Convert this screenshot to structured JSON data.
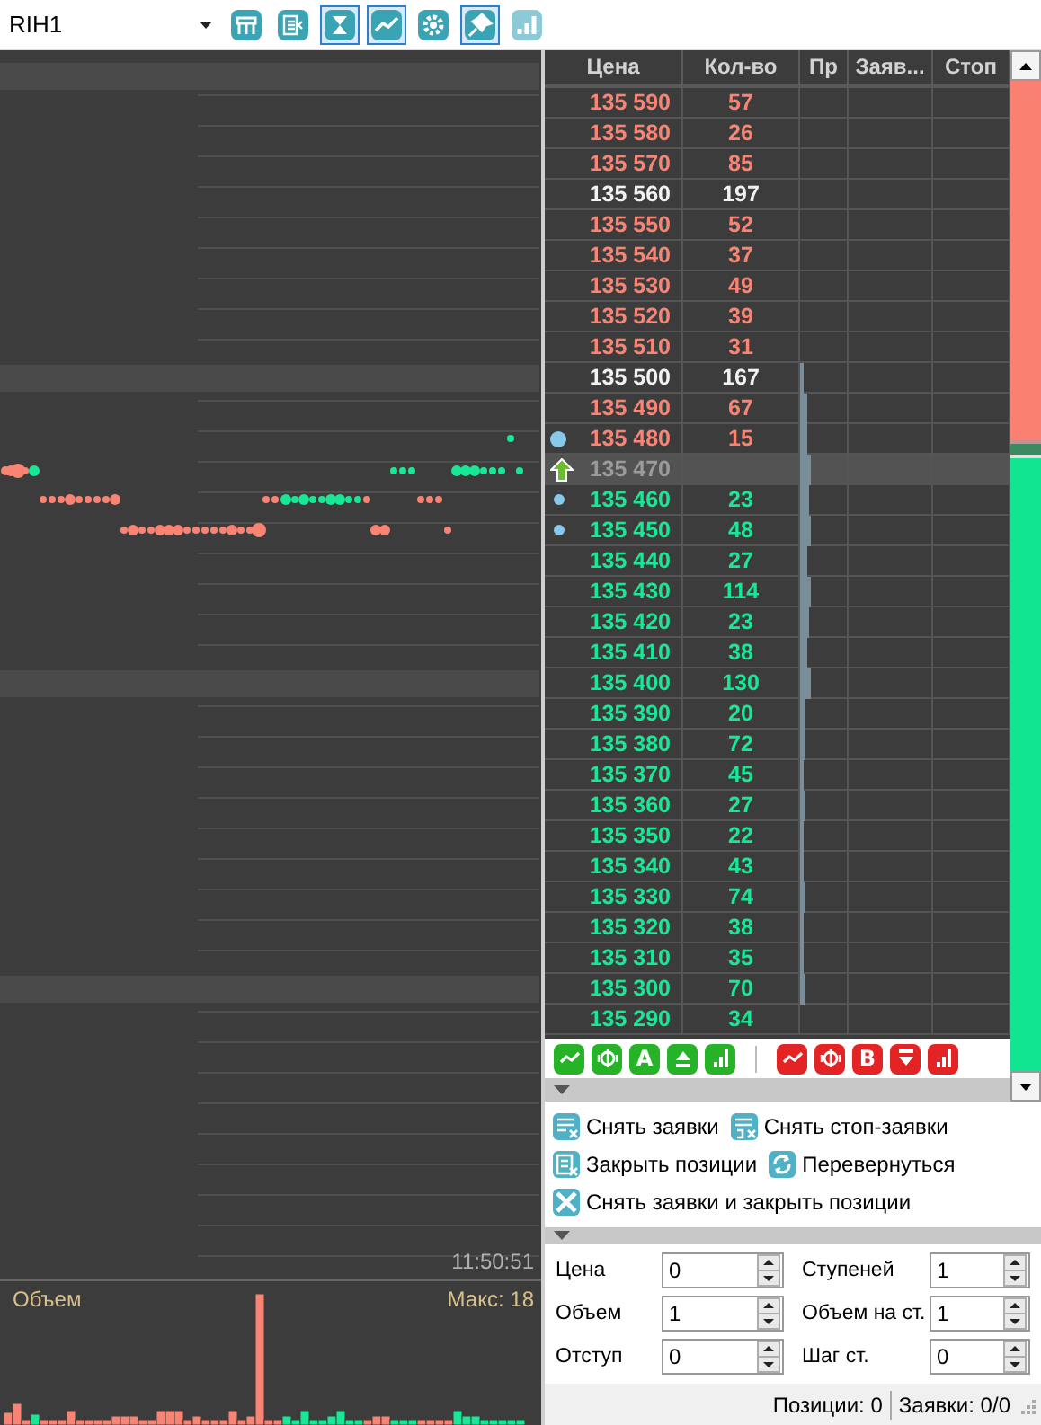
{
  "instrument": {
    "value": "RIH1"
  },
  "toolbar": [
    {
      "kind": "table",
      "selected": false
    },
    {
      "kind": "list",
      "selected": false
    },
    {
      "kind": "hourglass",
      "selected": true
    },
    {
      "kind": "line",
      "selected": true
    },
    {
      "kind": "gear",
      "selected": false
    },
    {
      "kind": "pin",
      "selected": true
    },
    {
      "kind": "bars",
      "selected": false
    }
  ],
  "chart": {
    "time": "11:50:51"
  },
  "volume": {
    "title": "Объем",
    "max": "Макс: 18"
  },
  "book": {
    "columns": [
      "Цена",
      "Кол-во",
      "Пр",
      "Заяв...",
      "Стоп"
    ],
    "rows": [
      {
        "price": "135 590",
        "qty": "57",
        "kind": "ask",
        "large": false
      },
      {
        "price": "135 580",
        "qty": "26",
        "kind": "ask",
        "large": false
      },
      {
        "price": "135 570",
        "qty": "85",
        "kind": "ask",
        "large": false
      },
      {
        "price": "135 560",
        "qty": "197",
        "kind": "ask",
        "large": true
      },
      {
        "price": "135 550",
        "qty": "52",
        "kind": "ask",
        "large": false
      },
      {
        "price": "135 540",
        "qty": "37",
        "kind": "ask",
        "large": false
      },
      {
        "price": "135 530",
        "qty": "49",
        "kind": "ask",
        "large": false
      },
      {
        "price": "135 520",
        "qty": "39",
        "kind": "ask",
        "large": false
      },
      {
        "price": "135 510",
        "qty": "31",
        "kind": "ask",
        "large": false
      },
      {
        "price": "135 500",
        "qty": "167",
        "kind": "ask",
        "large": true,
        "level": 0.08
      },
      {
        "price": "135 490",
        "qty": "67",
        "kind": "ask",
        "large": false,
        "level": 0.15
      },
      {
        "price": "135 480",
        "qty": "15",
        "kind": "ask",
        "large": false,
        "level": 0.15,
        "order_dot": true,
        "dot_large": true
      },
      {
        "price": "135 470",
        "kind": "spread",
        "level": 0.22
      },
      {
        "price": "135 460",
        "qty": "23",
        "kind": "bid",
        "large": false,
        "level": 0.18,
        "order_dot": true,
        "dot_large": false
      },
      {
        "price": "135 450",
        "qty": "48",
        "kind": "bid",
        "large": false,
        "level": 0.22,
        "order_dot": true,
        "dot_large": false
      },
      {
        "price": "135 440",
        "qty": "27",
        "kind": "bid",
        "large": false,
        "level": 0.15
      },
      {
        "price": "135 430",
        "qty": "114",
        "kind": "bid",
        "large": false,
        "level": 0.22
      },
      {
        "price": "135 420",
        "qty": "23",
        "kind": "bid",
        "large": false,
        "level": 0.18
      },
      {
        "price": "135 410",
        "qty": "38",
        "kind": "bid",
        "large": false,
        "level": 0.15
      },
      {
        "price": "135 400",
        "qty": "130",
        "kind": "bid",
        "large": false,
        "level": 0.22
      },
      {
        "price": "135 390",
        "qty": "20",
        "kind": "bid",
        "large": false,
        "level": 0.11
      },
      {
        "price": "135 380",
        "qty": "72",
        "kind": "bid",
        "large": false,
        "level": 0.11
      },
      {
        "price": "135 370",
        "qty": "45",
        "kind": "bid",
        "large": false,
        "level": 0.08
      },
      {
        "price": "135 360",
        "qty": "27",
        "kind": "bid",
        "large": false,
        "level": 0.11
      },
      {
        "price": "135 350",
        "qty": "22",
        "kind": "bid",
        "large": false,
        "level": 0.08
      },
      {
        "price": "135 340",
        "qty": "43",
        "kind": "bid",
        "large": false,
        "level": 0.08
      },
      {
        "price": "135 330",
        "qty": "74",
        "kind": "bid",
        "large": false,
        "level": 0.11
      },
      {
        "price": "135 320",
        "qty": "38",
        "kind": "bid",
        "large": false,
        "level": 0.08
      },
      {
        "price": "135 310",
        "qty": "35",
        "kind": "bid",
        "large": false,
        "level": 0.08
      },
      {
        "price": "135 300",
        "qty": "70",
        "kind": "bid",
        "large": false,
        "level": 0.11
      },
      {
        "price": "135 290",
        "qty": "34",
        "kind": "bid",
        "large": false
      }
    ]
  },
  "trade_buttons": [
    {
      "sell": false,
      "kind": "chart"
    },
    {
      "sell": false,
      "kind": "money"
    },
    {
      "sell": false,
      "kind": "letter",
      "text": "A"
    },
    {
      "sell": false,
      "kind": "up"
    },
    {
      "sell": false,
      "kind": "bars"
    },
    {
      "sell": true,
      "kind": "chart"
    },
    {
      "sell": true,
      "kind": "money"
    },
    {
      "sell": true,
      "kind": "letter",
      "text": "B"
    },
    {
      "sell": true,
      "kind": "down"
    },
    {
      "sell": true,
      "kind": "bars"
    }
  ],
  "actions": [
    [
      {
        "label": "Снять заявки",
        "kind": "cancel"
      },
      {
        "label": "Снять стоп-заявки",
        "kind": "cancel-stop"
      }
    ],
    [
      {
        "label": "Закрыть позиции",
        "kind": "close"
      },
      {
        "label": "Перевернуться",
        "kind": "reverse"
      }
    ],
    [
      {
        "label": "Снять заявки и закрыть позиции",
        "kind": "cancel-all"
      }
    ]
  ],
  "form": [
    [
      {
        "label": "Цена",
        "value": "0"
      },
      {
        "label": "Ступеней",
        "value": "1"
      }
    ],
    [
      {
        "label": "Объем",
        "value": "1"
      },
      {
        "label": "Объем на ст.",
        "value": "1"
      }
    ],
    [
      {
        "label": "Отступ",
        "value": "0"
      },
      {
        "label": "Шаг ст.",
        "value": "0"
      }
    ]
  ],
  "status": {
    "positions": "Позиции: 0",
    "orders": "Заявки: 0/0"
  }
}
